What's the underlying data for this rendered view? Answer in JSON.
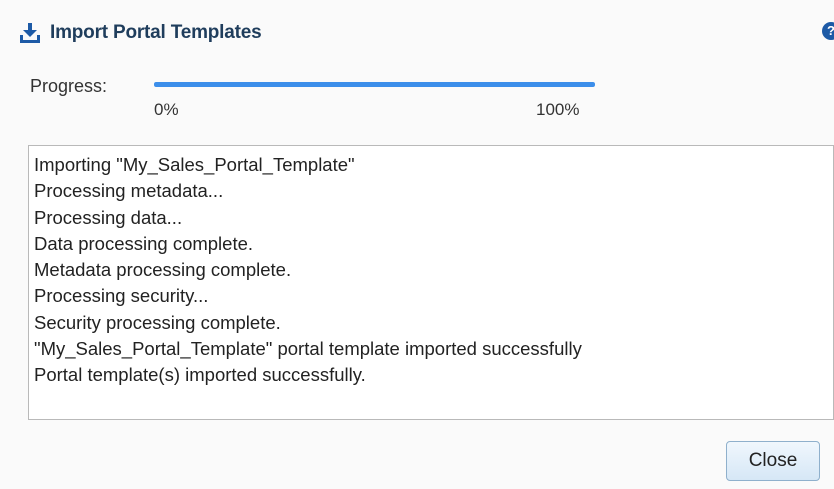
{
  "dialog": {
    "title": "Import Portal Templates",
    "title_icon": "download-icon",
    "help_icon": "help-icon",
    "help_glyph": "?"
  },
  "progress": {
    "label": "Progress:",
    "value_percent": 100,
    "min_label": "0%",
    "max_label": "100%",
    "color": "#3c8eea"
  },
  "log": {
    "lines": [
      "Importing \"My_Sales_Portal_Template\"",
      "Processing metadata...",
      "Processing data...",
      "Data processing complete.",
      "Metadata processing complete.",
      "Processing security...",
      "Security processing complete.",
      "\"My_Sales_Portal_Template\" portal template imported successfully",
      "Portal template(s) imported successfully."
    ]
  },
  "footer": {
    "close_label": "Close"
  }
}
